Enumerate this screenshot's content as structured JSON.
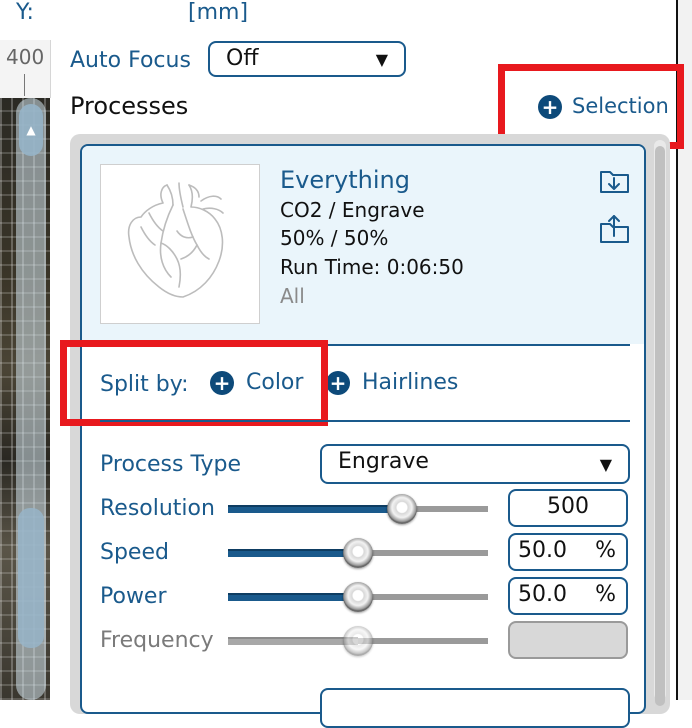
{
  "header": {
    "y_label": "Y:",
    "unit_label": "[mm]"
  },
  "ruler": {
    "value": "400"
  },
  "auto_focus": {
    "label": "Auto Focus",
    "value": "Off"
  },
  "processes": {
    "title": "Processes",
    "add_selection_label": "Selection",
    "item": {
      "name": "Everything",
      "laser_mode": "CO2 / Engrave",
      "power_speed": "50%  /  50%",
      "run_time": "Run Time: 0:06:50",
      "scope": "All"
    },
    "split": {
      "label": "Split by:",
      "color_label": "Color",
      "hairlines_label": "Hairlines"
    },
    "settings": {
      "process_type_label": "Process Type",
      "process_type_value": "Engrave",
      "resolution": {
        "label": "Resolution",
        "value": "500",
        "fraction": 0.69
      },
      "speed": {
        "label": "Speed",
        "value": "50.0",
        "unit": "%",
        "fraction": 0.5
      },
      "power": {
        "label": "Power",
        "value": "50.0",
        "unit": "%",
        "fraction": 0.5
      },
      "frequency": {
        "label": "Frequency",
        "value": "",
        "fraction": 0.5,
        "disabled": true
      }
    }
  },
  "colors": {
    "accent": "#1a5a8c",
    "highlight": "#e8191e"
  }
}
